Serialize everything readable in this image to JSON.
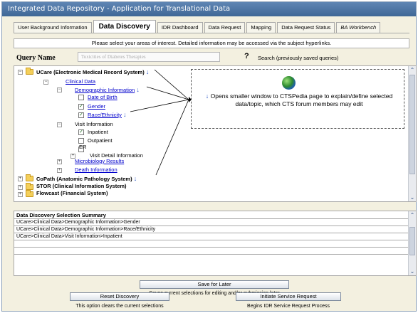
{
  "app": {
    "title": "Integrated Data Repository - Application for Translational Data"
  },
  "tabs": [
    {
      "label": "User Background Information"
    },
    {
      "label": "Data Discovery"
    },
    {
      "label": "IDR Dashboard"
    },
    {
      "label": "Data Request"
    },
    {
      "label": "Mapping"
    },
    {
      "label": "Data Request Status"
    },
    {
      "label": "BA Workbench"
    }
  ],
  "instructions": "Please select your areas of interest.  Detailed information may be accessed via the subject hyperlinks.",
  "query": {
    "label": "Query Name",
    "value": "Toxicities of Diabetes Therapies",
    "help_icon": "?",
    "hint": "Search (previously saved queries)"
  },
  "tree": {
    "ucare": "UCare (Electronic Medical Record System)",
    "clinical_data": "Clinical Data",
    "demographic": "Demographic Information",
    "dob": "Date of Birth",
    "gender": "Gender",
    "race": "Race/Ethnicity",
    "visit": "Visit Information",
    "inpatient": "Inpatient",
    "outpatient": "Outpatient",
    "er": "ER",
    "visit_detail": "Visit Detail Information",
    "microbiology": "Microbiology Results",
    "death": "Death Information",
    "copath": "CoPath (Anatomic Pathology System)",
    "stor": "STOR (Clinical Information System)",
    "flowcast": "Flowcast (Financial System)"
  },
  "checkboxes": {
    "dob": false,
    "gender": true,
    "race": true,
    "inpatient": true,
    "outpatient": false,
    "er": false
  },
  "callout": {
    "text": "Opens smaller window to CTSPedia page to explain/define selected data/topic, which CTS forum members may edit",
    "icon": "globe-icon"
  },
  "summary": {
    "title": "Data Discovery Selection Summary",
    "rows": [
      "UCare>Clinical Data>Demographic Information>Gender",
      "UCare>Clinical Data>Demographic Information>Race/Ethnicity",
      "UCare>Clinical Data>Visit Information>Inpatient",
      "",
      ""
    ]
  },
  "actions": {
    "save_label": "Save for Later",
    "save_caption": "Saves current selections for editing and/or submission later",
    "reset_label": "Reset Discovery",
    "reset_caption": "This option clears the current selections",
    "initiate_label": "Initiate Service Request",
    "initiate_caption": "Begins IDR Service Request Process"
  },
  "colors": {
    "title_bar": "#4a72a2",
    "link": "#0000cc",
    "panel_bg": "#f3f0e0",
    "info_icon": "#2a56c6"
  }
}
